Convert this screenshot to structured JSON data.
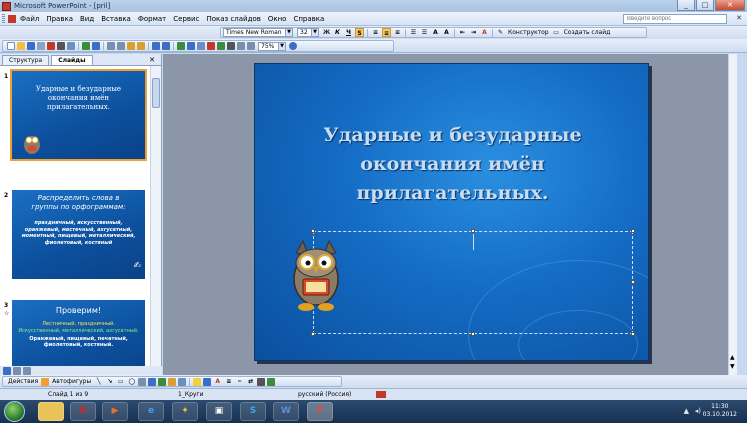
{
  "window": {
    "title": "Microsoft PowerPoint - [pril]",
    "btn_min": "_",
    "btn_max": "□",
    "btn_close": "✕"
  },
  "menu": {
    "items": [
      "Файл",
      "Правка",
      "Вид",
      "Вставка",
      "Формат",
      "Сервис",
      "Показ слайдов",
      "Окно",
      "Справка"
    ],
    "help_placeholder": "Введите вопрос",
    "close_doc": "✕"
  },
  "format_toolbar": {
    "font": "Times New Roman",
    "size": "32",
    "bold": "Ж",
    "italic": "К",
    "underline": "Ч",
    "shadow": "S",
    "designer": "Конструктор",
    "new_slide": "Создать слайд"
  },
  "standard_toolbar": {
    "zoom": "75%"
  },
  "left_pane": {
    "tab_outline": "Структура",
    "tab_slides": "Слайды",
    "close": "✕",
    "slides": [
      {
        "num": "1",
        "title": "Ударные и безударные окончания имён прилагательных."
      },
      {
        "num": "2",
        "heading": "Распределить слова в группы по орфограммам:",
        "words": "праздничный, искусственный, оранжевый, местечный, ахгусатный, моментный, пищевый, металлический, фиолетовый, костяный"
      },
      {
        "num": "3",
        "heading": "Проверим!",
        "yellow": "Лестничный, праздничный.",
        "green": "Искусственный, металлический, ахгусатный.",
        "white": "Оранжевый, пищевый, печатный, фиолетовый, костяный."
      }
    ]
  },
  "slide": {
    "title": "Ударные и безударные окончания имён прилагательных."
  },
  "draw_toolbar": {
    "actions": "Действия",
    "autoshapes": "Автофигуры"
  },
  "status": {
    "slide": "Слайд 1 из 9",
    "design": "1_Круги",
    "language": "русский (Россия)"
  },
  "taskbar": {
    "time": "11:30",
    "date": "03.10.2012",
    "apps": [
      "folder",
      "opera",
      "media",
      "ie",
      "cleaner",
      "desktop",
      "skype",
      "word",
      "powerpoint"
    ]
  },
  "colors": {
    "slide_bg": "#146cc4",
    "title_text": "#c9ddf2",
    "selection": "#f0a030"
  }
}
